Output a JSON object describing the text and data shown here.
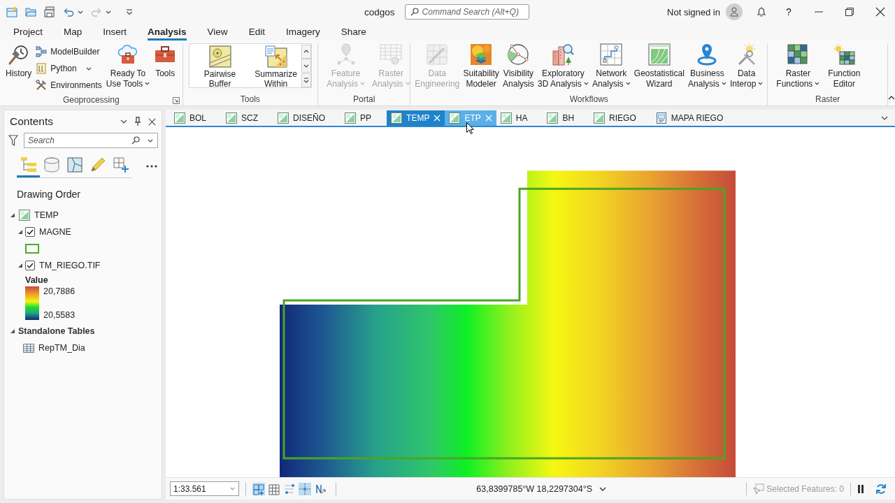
{
  "title_bar": {
    "title": "codgos",
    "search": {
      "placeholder": "Command Search (Alt+Q)"
    },
    "account": "Not signed in",
    "help": "?"
  },
  "menu_tabs": [
    {
      "label": "Project",
      "selected": false
    },
    {
      "label": "Map",
      "selected": false
    },
    {
      "label": "Insert",
      "selected": false
    },
    {
      "label": "Analysis",
      "selected": true
    },
    {
      "label": "View",
      "selected": false
    },
    {
      "label": "Edit",
      "selected": false
    },
    {
      "label": "Imagery",
      "selected": false
    },
    {
      "label": "Share",
      "selected": false
    }
  ],
  "ribbon": [
    {
      "label": "Geoprocessing",
      "launcher": true,
      "items": [
        {
          "kind": "large",
          "label": "History",
          "dropdown": false,
          "disabled": false
        },
        {
          "kind": "stack",
          "items": [
            {
              "label": "ModelBuilder",
              "dropdown": false
            },
            {
              "label": "Python",
              "dropdown": true
            },
            {
              "label": "Environments",
              "dropdown": false
            }
          ]
        },
        {
          "kind": "large",
          "label": "Ready To\nUse Tools",
          "dropdown": true,
          "disabled": false
        },
        {
          "kind": "large",
          "label": "Tools",
          "dropdown": false,
          "disabled": false
        }
      ]
    },
    {
      "label": "Tools",
      "items": [
        {
          "kind": "gallery",
          "items": [
            {
              "label": "Pairwise\nBuffer"
            },
            {
              "label": "Summarize\nWithin"
            }
          ]
        }
      ]
    },
    {
      "label": "Portal",
      "items": [
        {
          "kind": "large",
          "label": "Feature\nAnalysis",
          "dropdown": true,
          "disabled": true
        },
        {
          "kind": "large",
          "label": "Raster\nAnalysis",
          "dropdown": true,
          "disabled": true
        }
      ]
    },
    {
      "label": "Workflows",
      "items": [
        {
          "kind": "large",
          "label": "Data\nEngineering",
          "dropdown": false,
          "disabled": true
        },
        {
          "kind": "large",
          "label": "Suitability\nModeler",
          "dropdown": false,
          "disabled": false
        },
        {
          "kind": "large",
          "label": "Visibility\nAnalysis",
          "dropdown": false,
          "disabled": false
        },
        {
          "kind": "large",
          "label": "Exploratory\n3D Analysis",
          "dropdown": true,
          "disabled": false
        },
        {
          "kind": "large",
          "label": "Network\nAnalysis",
          "dropdown": true,
          "disabled": false
        },
        {
          "kind": "large",
          "label": "Geostatistical\nWizard",
          "dropdown": false,
          "disabled": false
        },
        {
          "kind": "large",
          "label": "Business\nAnalysis",
          "dropdown": true,
          "disabled": false
        },
        {
          "kind": "large",
          "label": "Data\nInterop",
          "dropdown": true,
          "disabled": false
        }
      ]
    },
    {
      "label": "Raster",
      "items": [
        {
          "kind": "large",
          "label": "Raster\nFunctions",
          "dropdown": true,
          "disabled": false
        },
        {
          "kind": "large",
          "label": "Function\nEditor",
          "dropdown": false,
          "disabled": false
        }
      ]
    }
  ],
  "contents": {
    "title": "Contents",
    "search": {
      "placeholder": "Search"
    },
    "views": [
      {
        "selected": true
      },
      {
        "selected": false
      },
      {
        "selected": false
      },
      {
        "selected": false
      },
      {
        "selected": false
      }
    ],
    "heading": "Drawing Order",
    "tree": [
      {
        "kind": "map",
        "name": "TEMP",
        "expanded": true,
        "children": [
          {
            "kind": "polygon",
            "name": "MAGNE",
            "checked": true,
            "expanded": true
          },
          {
            "kind": "raster",
            "name": "TM_RIEGO.TIF",
            "checked": true,
            "expanded": true,
            "legend": {
              "title": "Value",
              "high": "20,7886",
              "low": "20,5583"
            }
          }
        ]
      },
      {
        "kind": "group",
        "name": "Standalone Tables",
        "expanded": true,
        "children": [
          {
            "kind": "table",
            "name": "RepTM_Dia"
          }
        ]
      }
    ]
  },
  "map_tabs": [
    {
      "label": "BOL",
      "kind": "map",
      "selected": false,
      "hovered": false
    },
    {
      "label": "SCZ",
      "kind": "map",
      "selected": false,
      "hovered": false
    },
    {
      "label": "DISEÑO",
      "kind": "map",
      "selected": false,
      "hovered": false
    },
    {
      "label": "PP",
      "kind": "map",
      "selected": false,
      "hovered": false
    },
    {
      "label": "TEMP",
      "kind": "map",
      "selected": true,
      "hovered": false
    },
    {
      "label": "ETP",
      "kind": "map",
      "selected": false,
      "hovered": true
    },
    {
      "label": "HA",
      "kind": "map",
      "selected": false,
      "hovered": false
    },
    {
      "label": "BH",
      "kind": "map",
      "selected": false,
      "hovered": false
    },
    {
      "label": "RIEGO",
      "kind": "map",
      "selected": false,
      "hovered": false
    },
    {
      "label": "MAPA RIEGO",
      "kind": "layout",
      "selected": false,
      "hovered": false
    }
  ],
  "status_bar": {
    "scale": "1:33.561",
    "tools": [
      {
        "on": true
      },
      {
        "on": false
      },
      {
        "on": false
      },
      {
        "on": true
      },
      {
        "on": false
      }
    ],
    "coordinates": "63,8399785°W 18,2297304°S",
    "selected_features": "Selected Features: 0"
  }
}
